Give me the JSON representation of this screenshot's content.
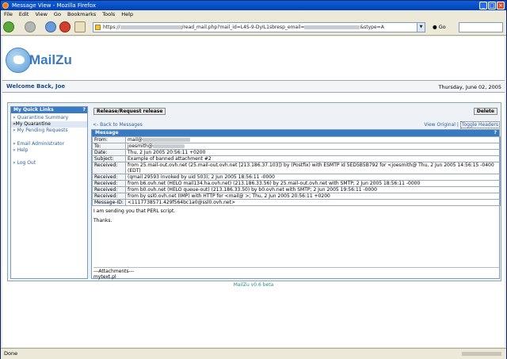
{
  "window": {
    "title": "Message View - Mozilla Firefox"
  },
  "menu": [
    "File",
    "Edit",
    "View",
    "Go",
    "Bookmarks",
    "Tools",
    "Help"
  ],
  "toolbar": {
    "url_prefix": "https://",
    "url_mid": "/read_mail.php?mail_id=L4S-9-DyIL1sbresp_email=",
    "url_suffix": "&stype=A",
    "go_label": "Go"
  },
  "app": {
    "name": "MailZu",
    "footer": "MailZu v0.6 beta"
  },
  "header": {
    "welcome": "Welcome Back, Joe",
    "date": "Thursday, June 02, 2005"
  },
  "sidebar": {
    "title": "My Quick Links",
    "help": "?",
    "items": [
      {
        "label": "» Quarantine Summary",
        "active": false
      },
      {
        "label": "»My Quarantine",
        "active": true
      },
      {
        "label": "» My Pending Requests",
        "active": false
      },
      {
        "label": "» Email Administrator",
        "active": false
      },
      {
        "label": "» Help",
        "active": false
      },
      {
        "label": "» Log Out",
        "active": false
      }
    ]
  },
  "actions": {
    "release": "Release/Request release",
    "delete": "Delete",
    "back": "<- Back to Messages",
    "view_original": "View Original",
    "toggle_headers": "Toggle Headers",
    "sep": "|"
  },
  "message": {
    "title": "Message",
    "help": "?",
    "headers": [
      {
        "key": "From:",
        "value": "mail@"
      },
      {
        "key": "To:",
        "value": "joesmith@"
      },
      {
        "key": "Date:",
        "value": "Thu, 2 Jun 2005 20:56:11 +0200"
      },
      {
        "key": "Subject:",
        "value": "Example of banned attachment #2"
      },
      {
        "key": "Received:",
        "value": "from 25.mail-out.ovh.net (25.mail-out.ovh.net [213.186.37.103]) by (Postfix) with ESMTP id 5ED5B5B792 for <joesmith@ Thu, 2 Jun 2005 14:56:15 -0400 (EDT)"
      },
      {
        "key": "Received:",
        "value": "(qmail 29593 invoked by uid 503); 2 Jun 2005 18:56:11 -0000"
      },
      {
        "key": "Received:",
        "value": "from b6.ovh.net (HELO mail134.ha.ovh.net) (213.186.33.56) by 25.mail-out.ovh.net with SMTP; 2 Jun 2005 18:56:11 -0000"
      },
      {
        "key": "Received:",
        "value": "from b0.ovh.net (HELO queue-out) (213.186.33.50) by b0.ovh.net with SMTP; 2 Jun 2005 19:56:11 -0000"
      },
      {
        "key": "Received:",
        "value": "from by ssl0.ovh.net (IMP) with HTTP for <mail@ >; Thu, 2 Jun 2005 20:56:11 +0200"
      },
      {
        "key": "Message-ID:",
        "value": "<1117738571.429f564bc1a0@ssl0.ovh.net>"
      }
    ],
    "body_line1": "I am sending you that PERL script.",
    "body_line2": "Thanks.",
    "attachments_label": "---Attachments---",
    "attachment_file": "mytext.pl"
  },
  "status": {
    "text": "Done"
  }
}
